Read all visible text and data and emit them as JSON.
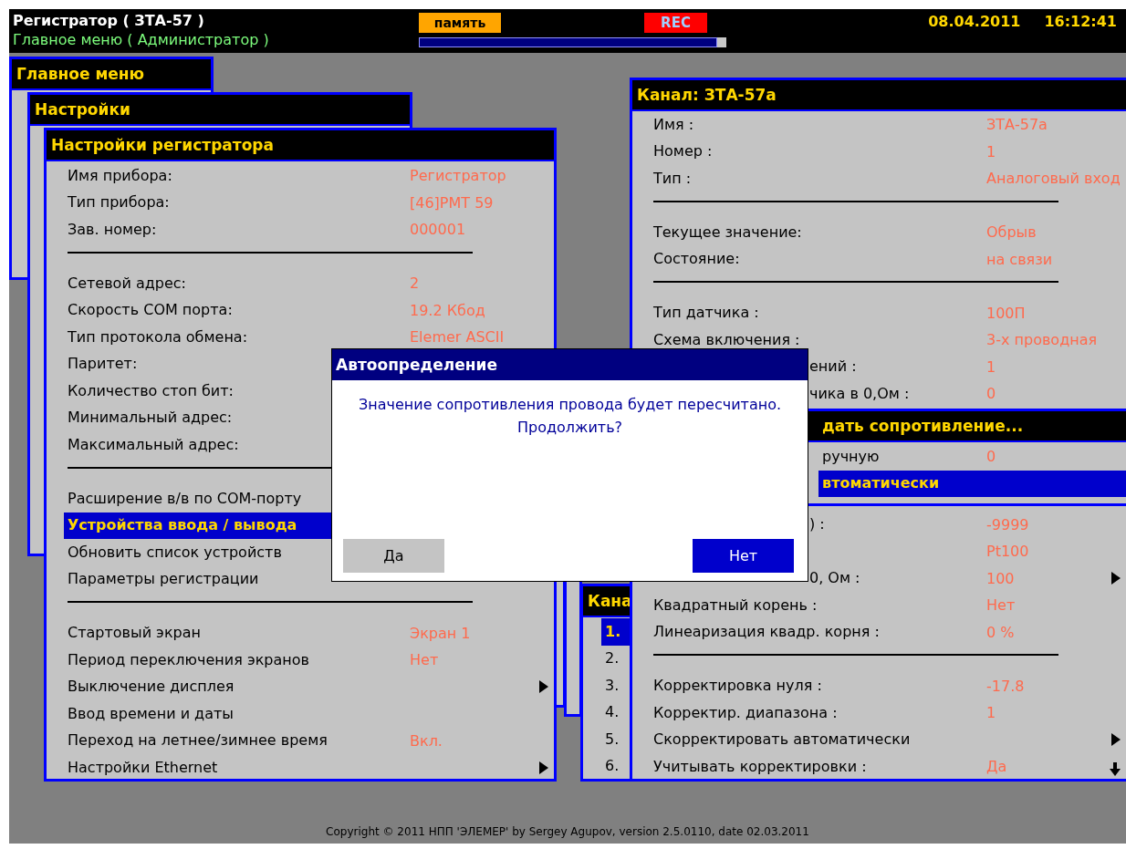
{
  "header": {
    "title": "Регистратор ( ЗТА-57 )",
    "subtitle": "Главное меню ( Администратор )",
    "memory_label": "память",
    "rec_label": "REC",
    "progress": {
      "level": 0.97
    },
    "date": "08.04.2011",
    "time": "16:12:41"
  },
  "main_menu": {
    "title": "Главное меню"
  },
  "settings": {
    "title": "Настройки"
  },
  "recorder_settings": {
    "title": "Настройки регистратора",
    "rows": [
      {
        "kind": "item",
        "label": "Имя прибора:",
        "value": "Регистратор",
        "selected": false,
        "submenu": false
      },
      {
        "kind": "item",
        "label": "Тип прибора:",
        "value": "[46]РМТ 59",
        "selected": false,
        "submenu": false
      },
      {
        "kind": "item",
        "label": "Зав. номер:",
        "value": "000001",
        "selected": false,
        "submenu": false
      },
      {
        "kind": "divider"
      },
      {
        "kind": "item",
        "label": "Сетевой адрес:",
        "value": "2",
        "selected": false,
        "submenu": false
      },
      {
        "kind": "item",
        "label": "Скорость COM порта:",
        "value": "19.2 Кбод",
        "selected": false,
        "submenu": false
      },
      {
        "kind": "item",
        "label": "Тип протокола обмена:",
        "value": "Elemer ASCII",
        "selected": false,
        "submenu": false
      },
      {
        "kind": "item",
        "label": "Паритет:",
        "selected": false
      },
      {
        "kind": "item",
        "label": "Количество стоп бит:",
        "selected": false
      },
      {
        "kind": "item",
        "label": "Минимальный адрес:",
        "selected": false
      },
      {
        "kind": "item",
        "label": "Максимальный адрес:",
        "selected": false
      },
      {
        "kind": "divider"
      },
      {
        "kind": "item",
        "label": "Расширение в/в по COM-порту",
        "selected": false
      },
      {
        "kind": "item",
        "label": "Устройства ввода / вывода",
        "selected": true
      },
      {
        "kind": "item",
        "label": "Обновить список устройств",
        "selected": false
      },
      {
        "kind": "item",
        "label": "Параметры регистрации",
        "selected": false,
        "submenu": false
      },
      {
        "kind": "divider"
      },
      {
        "kind": "item",
        "label": "Стартовый экран",
        "value": "Экран 1",
        "selected": false,
        "submenu": false
      },
      {
        "kind": "item",
        "label": "Период переключения экранов",
        "value": "Нет",
        "selected": false,
        "submenu": false
      },
      {
        "kind": "item",
        "label": "Выключение дисплея",
        "selected": false,
        "submenu": true
      },
      {
        "kind": "item",
        "label": "Ввод времени и даты",
        "selected": false,
        "submenu": false
      },
      {
        "kind": "item",
        "label": "Переход на летнее/зимнее время",
        "value": "Вкл.",
        "selected": false,
        "submenu": false
      },
      {
        "kind": "item",
        "label": "Настройки Ethernet",
        "selected": false,
        "submenu": true
      }
    ]
  },
  "channel_list": {
    "title": "Кана",
    "rows": [
      {
        "kind": "item",
        "label": "1.",
        "selected": true
      },
      {
        "kind": "item",
        "label": "2.",
        "selected": false
      },
      {
        "kind": "item",
        "label": "3.",
        "selected": false
      },
      {
        "kind": "item",
        "label": "4.",
        "selected": false
      },
      {
        "kind": "item",
        "label": "5.",
        "selected": false
      },
      {
        "kind": "item",
        "label": "6.",
        "selected": false
      }
    ]
  },
  "channel": {
    "title": "Канал: ЗТА-57а",
    "rows_upper": [
      {
        "kind": "item",
        "label": "Имя :",
        "value": "ЗТА-57а",
        "selected": false,
        "submenu": false
      },
      {
        "kind": "item",
        "label": "Номер :",
        "value": "1",
        "selected": false,
        "submenu": false
      },
      {
        "kind": "item",
        "label": "Тип :",
        "value": "Аналоговый вход",
        "selected": false
      },
      {
        "kind": "divider"
      },
      {
        "kind": "item",
        "label": "Текущее значение:",
        "value": "Обрыв",
        "selected": false,
        "submenu": false
      },
      {
        "kind": "item",
        "label": "Состояние:",
        "value": "на связи",
        "selected": false,
        "submenu": false
      },
      {
        "kind": "divider"
      },
      {
        "kind": "item",
        "label": "Тип датчика :",
        "value": "100П",
        "selected": false,
        "submenu": false
      },
      {
        "kind": "item",
        "label": "Схема включения :",
        "value": "3-х проводная",
        "selected": false,
        "submenu": false
      },
      {
        "kind": "clipped",
        "label": "ений :",
        "value": "1",
        "selected": false,
        "submenu": false
      },
      {
        "kind": "clipped",
        "label": "чика в 0,Ом :",
        "value": "0",
        "selected": false,
        "submenu": false
      }
    ],
    "rows_lower": [
      {
        "kind": "clipped",
        "label": ") :",
        "value": "-9999",
        "selected": false,
        "submenu": false
      },
      {
        "kind": "clipped",
        "value": "Pt100",
        "selected": false,
        "submenu": false
      },
      {
        "kind": "clipped",
        "label": "0, Ом :",
        "value": "100",
        "selected": false,
        "submenu": true
      },
      {
        "kind": "item",
        "label": "Квадратный корень :",
        "value": "Нет",
        "selected": false,
        "submenu": false
      },
      {
        "kind": "item",
        "label": "Линеаризация квадр. корня :",
        "value": "0 %",
        "selected": false,
        "submenu": false
      },
      {
        "kind": "divider"
      },
      {
        "kind": "item",
        "label": "Корректировка нуля :",
        "value": "-17.8",
        "selected": false,
        "submenu": false
      },
      {
        "kind": "item",
        "label": "Корректир. диапазона :",
        "value": "1",
        "selected": false,
        "submenu": false
      },
      {
        "kind": "item",
        "label": "Скорректировать автоматически",
        "selected": false,
        "submenu": true
      },
      {
        "kind": "item",
        "label": "Учитывать корректировки :",
        "value": "Да",
        "selected": false,
        "submenu": false
      }
    ]
  },
  "submenu": {
    "title": "дать сопротивление...",
    "rows": [
      {
        "kind": "item",
        "label": "ручную",
        "value": "0",
        "selected": false,
        "submenu": false
      },
      {
        "kind": "item",
        "label": "втоматически",
        "selected": true,
        "submenu": false
      }
    ]
  },
  "dialog": {
    "title": "Автоопределение",
    "message": "Значение сопротивления провода будет пересчитано.\nПродолжить?",
    "buttons": [
      {
        "label": "Да",
        "selected": false
      },
      {
        "label": "Нет",
        "selected": true
      }
    ]
  },
  "footer": "Copyright © 2011 НПП 'ЭЛЕМЕР' by Sergey Agupov, version 2.5.0110, date 02.03.2011"
}
